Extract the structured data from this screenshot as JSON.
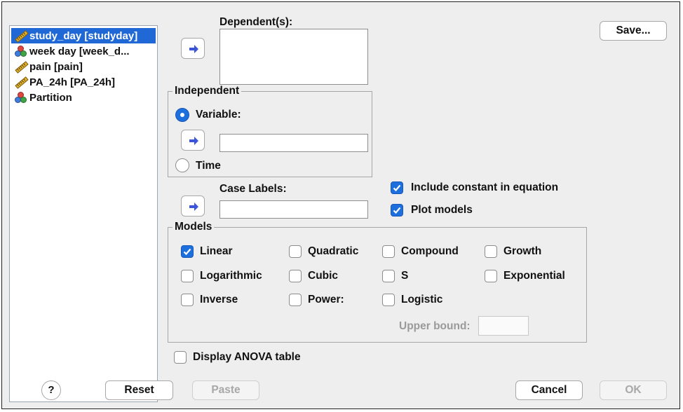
{
  "variables": [
    {
      "label": "study_day [studyday]",
      "icon": "scale-ruler-icon",
      "selected": true
    },
    {
      "label": "week day [week_d...",
      "icon": "nominal-icon",
      "selected": false
    },
    {
      "label": "pain [pain]",
      "icon": "scale-ruler-icon",
      "selected": false
    },
    {
      "label": "PA_24h [PA_24h]",
      "icon": "scale-ruler-icon",
      "selected": false
    },
    {
      "label": "Partition",
      "icon": "nominal-icon",
      "selected": false
    }
  ],
  "dependents": {
    "label": "Dependent(s):"
  },
  "independent": {
    "title": "Independent",
    "variable_label": "Variable:",
    "time_label": "Time",
    "selected": "Variable"
  },
  "case_labels": {
    "label": "Case Labels:"
  },
  "options": {
    "include_constant": {
      "label": "Include constant in equation",
      "checked": true
    },
    "plot_models": {
      "label": "Plot models",
      "checked": true
    }
  },
  "models": {
    "title": "Models",
    "linear": {
      "label": "Linear",
      "checked": true
    },
    "quadratic": {
      "label": "Quadratic",
      "checked": false
    },
    "compound": {
      "label": "Compound",
      "checked": false
    },
    "growth": {
      "label": "Growth",
      "checked": false
    },
    "logarithmic": {
      "label": "Logarithmic",
      "checked": false
    },
    "cubic": {
      "label": "Cubic",
      "checked": false
    },
    "s": {
      "label": "S",
      "checked": false
    },
    "exponential": {
      "label": "Exponential",
      "checked": false
    },
    "inverse": {
      "label": "Inverse",
      "checked": false
    },
    "power": {
      "label": "Power:",
      "checked": false
    },
    "logistic": {
      "label": "Logistic",
      "checked": false
    },
    "upper_bound_label": "Upper bound:"
  },
  "display_anova": {
    "label": "Display ANOVA table",
    "checked": false
  },
  "buttons": {
    "save": "Save...",
    "help": "?",
    "reset": "Reset",
    "paste": "Paste",
    "cancel": "Cancel",
    "ok": "OK"
  },
  "colors": {
    "accent": "#1e6fde",
    "selection": "#1f68d6",
    "arrow": "#3b55d6"
  }
}
